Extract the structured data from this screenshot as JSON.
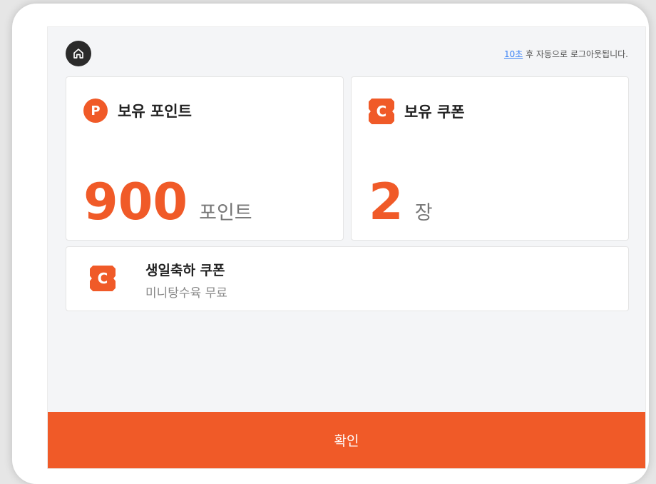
{
  "header": {
    "home_icon": "home-icon",
    "logout_seconds": "10초",
    "logout_text": " 후 자동으로 로그아웃됩니다."
  },
  "points": {
    "icon_letter": "P",
    "title": "보유 포인트",
    "value": "900",
    "unit": "포인트"
  },
  "coupons": {
    "icon_letter": "C",
    "title": "보유 쿠폰",
    "value": "2",
    "unit": "장"
  },
  "birthday_coupon": {
    "icon_letter": "C",
    "title": "생일축하 쿠폰",
    "subtitle": "미니탕수육 무료"
  },
  "footer": {
    "confirm_label": "확인"
  },
  "colors": {
    "accent": "#f05a28",
    "home_bg": "#2b2b2b",
    "link": "#3b82f6"
  }
}
